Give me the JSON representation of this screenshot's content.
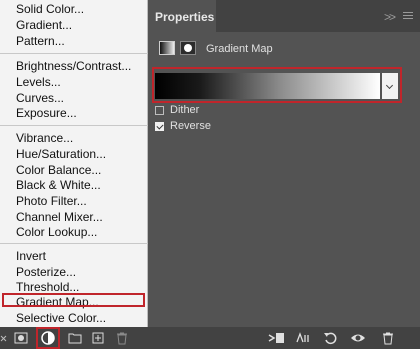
{
  "menu": {
    "items": [
      {
        "label": "Solid Color..."
      },
      {
        "label": "Gradient..."
      },
      {
        "label": "Pattern..."
      },
      {
        "label": "Brightness/Contrast..."
      },
      {
        "label": "Levels..."
      },
      {
        "label": "Curves..."
      },
      {
        "label": "Exposure..."
      },
      {
        "label": "Vibrance..."
      },
      {
        "label": "Hue/Saturation..."
      },
      {
        "label": "Color Balance..."
      },
      {
        "label": "Black & White..."
      },
      {
        "label": "Photo Filter..."
      },
      {
        "label": "Channel Mixer..."
      },
      {
        "label": "Color Lookup..."
      },
      {
        "label": "Invert"
      },
      {
        "label": "Posterize..."
      },
      {
        "label": "Threshold..."
      },
      {
        "label": "Gradient Map..."
      },
      {
        "label": "Selective Color..."
      }
    ],
    "highlighted": "Gradient Map..."
  },
  "properties": {
    "tab_label": "Properties",
    "collapse_glyph": ">>",
    "adjustment_title": "Gradient Map",
    "dither_label": "Dither",
    "dither_checked": false,
    "reverse_label": "Reverse",
    "reverse_checked": true
  },
  "toolbar": {
    "icons": [
      "clip-icon",
      "visibility-eye-icon",
      "reset-icon",
      "toggle-view-icon",
      "delete-icon"
    ]
  },
  "colors": {
    "highlight": "#c0252b",
    "panel": "#535353",
    "menu": "#f3f3f3"
  }
}
